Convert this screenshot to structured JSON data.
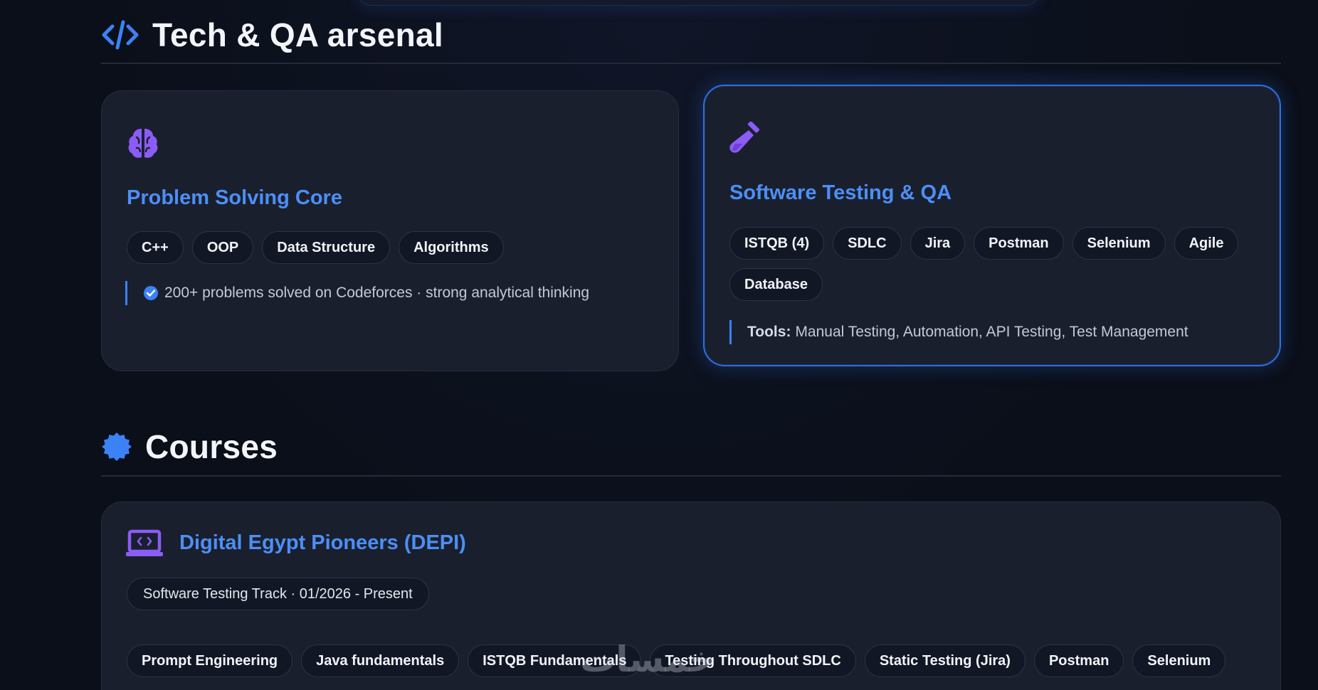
{
  "tech_section": {
    "title": "Tech & QA arsenal",
    "icon": "code-icon"
  },
  "problem_card": {
    "icon": "brain-icon",
    "title": "Problem Solving Core",
    "chips": [
      "C++",
      "OOP",
      "Data Structure",
      "Algorithms"
    ],
    "note_icon": "check-circle-icon",
    "note": "200+ problems solved on Codeforces · strong analytical thinking"
  },
  "testing_card": {
    "icon": "test-tube-icon",
    "title": "Software Testing & QA",
    "chips": [
      "ISTQB (4)",
      "SDLC",
      "Jira",
      "Postman",
      "Selenium",
      "Agile",
      "Database"
    ],
    "tools_label": "Tools:",
    "tools_value": "Manual Testing, Automation, API Testing, Test Management"
  },
  "courses_section": {
    "title": "Courses",
    "icon": "badge-icon"
  },
  "depi_card": {
    "icon": "laptop-code-icon",
    "title": "Digital Egypt Pioneers (DEPI)",
    "period": "Software Testing Track · 01/2026 - Present",
    "chips": [
      "Prompt Engineering",
      "Java fundamentals",
      "ISTQB Fundamentals",
      "Testing Throughout SDLC",
      "Static Testing (Jira)",
      "Postman",
      "Selenium"
    ]
  },
  "watermark": "خمسات",
  "colors": {
    "accent": "#4c8ff5",
    "icon_purple": "#8b5cf6",
    "background": "#0b0f1a",
    "card": "#1a1f2e"
  }
}
